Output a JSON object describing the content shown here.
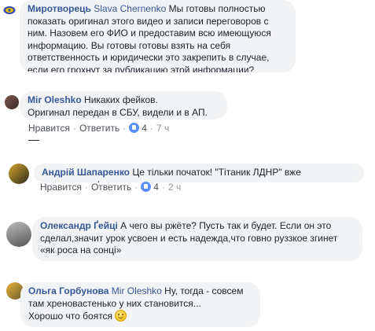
{
  "comments": [
    {
      "author": "Миротворець",
      "mention": "Slava Chernenko",
      "text": "Мы готовы полностью показать оригинал этого видео и записи переговоров с ним. Назовем его ФИО и предоставим всю имеющуюся информацию. Вы готовы готовы взять на себя ответственность и юридически это закрепить в случае, если его грохнут за публикацию этой информации?"
    },
    {
      "author": "Mir Oleshko",
      "text_line1": "Никаких фейков.",
      "text_line2": "Оригинал передан в СБУ, видели и в АП.",
      "like_label": "Нравится",
      "reply_label": "Ответить",
      "likes": "4",
      "time": "7 ч"
    },
    {
      "author": "Андрій Шапаренко",
      "text": "Це тільки початок! \"Тітаник ЛДНР\" вже занурюється!",
      "like_label": "Нравится",
      "reply_label": "Ответить",
      "likes": "4",
      "time": "2 ч"
    },
    {
      "author": "Олександр Ґейці",
      "text": "А чего вы ржёте? Пусть так и будет. Если он это сделал,значит урок усвоен и есть надежда,что говно руззкое згинет «як роса на сонці»"
    },
    {
      "author": "Ольга Горбунова",
      "mention": "Mir Oleshko",
      "text_line1": "Ну, тогда - совсем там хреновастенько у них становится...",
      "text_line2": "Хорошо что боятся"
    }
  ],
  "colors": {
    "link": "#365899",
    "bubble": "#f2f3f5",
    "meta": "#90949c",
    "like": "#5890ff"
  }
}
